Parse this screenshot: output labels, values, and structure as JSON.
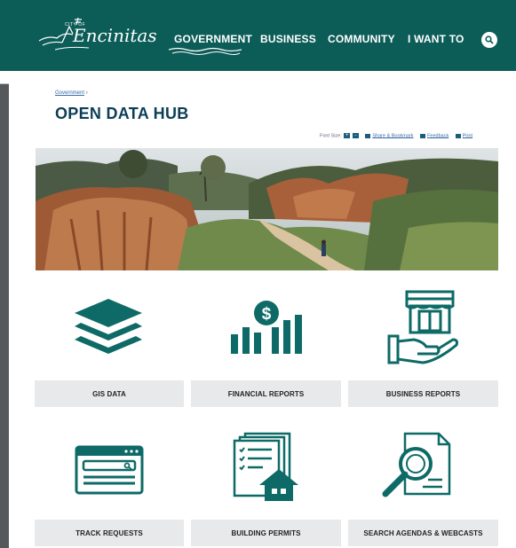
{
  "header": {
    "logo_small": "CITY OF",
    "logo_text": "Encinitas",
    "nav": [
      "GOVERNMENT",
      "BUSINESS",
      "COMMUNITY",
      "I WANT TO"
    ]
  },
  "breadcrumb": {
    "parent": "Government",
    "sep": "›"
  },
  "page_title": "OPEN DATA HUB",
  "tools": {
    "font_size_label": "Font Size:",
    "increase": "+",
    "decrease": "-",
    "share": "Share & Bookmark",
    "feedback": "Feedback",
    "print": "Print"
  },
  "tiles": [
    {
      "label": "GIS DATA",
      "icon": "layers-icon"
    },
    {
      "label": "FINANCIAL REPORTS",
      "icon": "financial-chart-icon"
    },
    {
      "label": "BUSINESS REPORTS",
      "icon": "storefront-hand-icon"
    },
    {
      "label": "TRACK REQUESTS",
      "icon": "search-window-icon"
    },
    {
      "label": "BUILDING PERMITS",
      "icon": "documents-house-icon"
    },
    {
      "label": "SEARCH AGENDAS & WEBCASTS",
      "icon": "document-magnifier-icon"
    }
  ],
  "colors": {
    "brand": "#0c5c58",
    "title": "#0c3f55",
    "tile_bg": "#e7e9ea",
    "icon": "#0d6a66"
  }
}
